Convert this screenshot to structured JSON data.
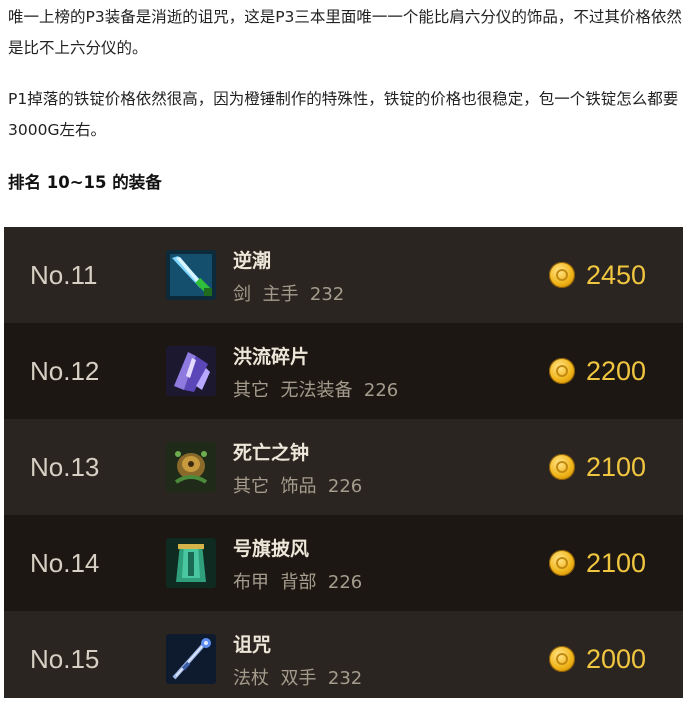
{
  "article": {
    "paragraph1": "唯一上榜的P3装备是消逝的诅咒，这是P3三本里面唯一一个能比肩六分仪的饰品，不过其价格依然是比不上六分仪的。",
    "paragraph2": "P1掉落的铁锭价格依然很高，因为橙锤制作的特殊性，铁锭的价格也很稳定，包一个铁锭怎么都要3000G左右。",
    "heading": "排名 10~15 的装备"
  },
  "items": [
    {
      "rank": "No.11",
      "name": "逆潮",
      "meta": "剑  主手  232",
      "price": "2450",
      "icon": "sword-icon"
    },
    {
      "rank": "No.12",
      "name": "洪流碎片",
      "meta": "其它  无法装备  226",
      "price": "2200",
      "icon": "crystal-shard-icon"
    },
    {
      "rank": "No.13",
      "name": "死亡之钟",
      "meta": "其它  饰品  226",
      "price": "2100",
      "icon": "bell-trinket-icon"
    },
    {
      "rank": "No.14",
      "name": "号旗披风",
      "meta": "布甲  背部  226",
      "price": "2100",
      "icon": "cloak-icon"
    },
    {
      "rank": "No.15",
      "name": "诅咒",
      "meta": "法杖  双手  232",
      "price": "2000",
      "icon": "staff-icon"
    }
  ],
  "colors": {
    "coin": "#f1b419",
    "price_text": "#f0c640",
    "row_dark": "#1c1712",
    "row_light": "#2a2520"
  }
}
